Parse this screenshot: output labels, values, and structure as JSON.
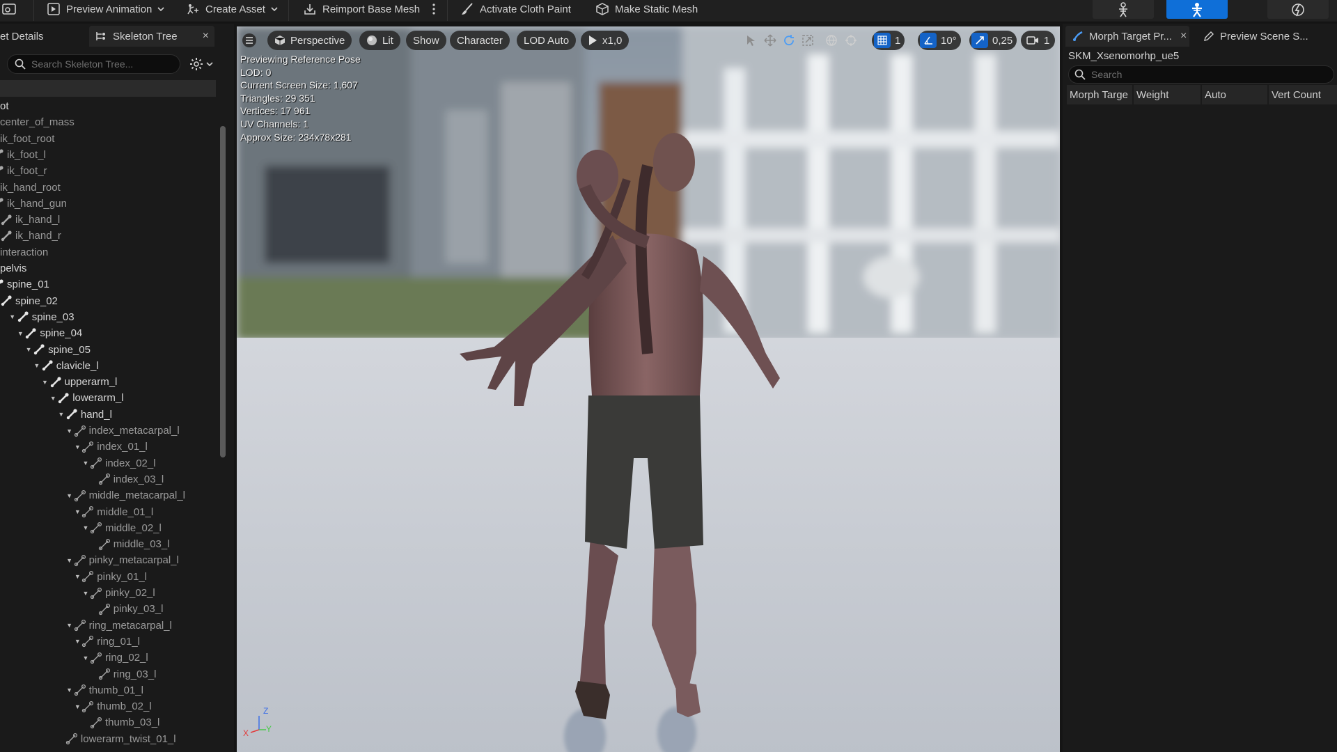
{
  "toolbar": {
    "preview_animation": "Preview Animation",
    "create_asset": "Create Asset",
    "reimport_base_mesh": "Reimport Base Mesh",
    "activate_cloth_paint": "Activate Cloth Paint",
    "make_static_mesh": "Make Static Mesh",
    "modes": [
      {
        "name": "skeleton-mode-icon",
        "active": false
      },
      {
        "name": "mesh-mode-icon",
        "active": true
      },
      {
        "name": "animation-mode-icon",
        "active": false
      }
    ]
  },
  "left_panel": {
    "tab_details": "et Details",
    "tab_skeleton_tree": "Skeleton Tree",
    "close": "×",
    "search_placeholder": "Search Skeleton Tree...",
    "tree": [
      {
        "label": "ot",
        "depth": 0,
        "dim": false,
        "arrow": false,
        "bone": false
      },
      {
        "label": "center_of_mass",
        "depth": 0,
        "dim": true,
        "arrow": false,
        "bone": false
      },
      {
        "label": "ik_foot_root",
        "depth": 0,
        "dim": true,
        "arrow": false,
        "bone": false
      },
      {
        "label": "ik_foot_l",
        "depth": 0,
        "dim": true,
        "arrow": false,
        "bone": "partial"
      },
      {
        "label": "ik_foot_r",
        "depth": 0,
        "dim": true,
        "arrow": false,
        "bone": "partial"
      },
      {
        "label": "ik_hand_root",
        "depth": 0,
        "dim": true,
        "arrow": false,
        "bone": false
      },
      {
        "label": "ik_hand_gun",
        "depth": 0,
        "dim": true,
        "arrow": false,
        "bone": "partial"
      },
      {
        "label": "ik_hand_l",
        "depth": 0,
        "dim": true,
        "arrow": false,
        "bone": true
      },
      {
        "label": "ik_hand_r",
        "depth": 0,
        "dim": true,
        "arrow": false,
        "bone": true
      },
      {
        "label": "interaction",
        "depth": 0,
        "dim": true,
        "arrow": false,
        "bone": false
      },
      {
        "label": "pelvis",
        "depth": 0,
        "dim": false,
        "arrow": false,
        "bone": false
      },
      {
        "label": "spine_01",
        "depth": 0,
        "dim": false,
        "arrow": false,
        "bone": "partial"
      },
      {
        "label": "spine_02",
        "depth": 0,
        "dim": false,
        "arrow": false,
        "bone": true
      },
      {
        "label": "spine_03",
        "depth": 1,
        "dim": false,
        "arrow": true,
        "bone": true
      },
      {
        "label": "spine_04",
        "depth": 2,
        "dim": false,
        "arrow": true,
        "bone": true
      },
      {
        "label": "spine_05",
        "depth": 3,
        "dim": false,
        "arrow": true,
        "bone": true
      },
      {
        "label": "clavicle_l",
        "depth": 4,
        "dim": false,
        "arrow": true,
        "bone": true
      },
      {
        "label": "upperarm_l",
        "depth": 5,
        "dim": false,
        "arrow": true,
        "bone": true
      },
      {
        "label": "lowerarm_l",
        "depth": 6,
        "dim": false,
        "arrow": true,
        "bone": true
      },
      {
        "label": "hand_l",
        "depth": 7,
        "dim": false,
        "arrow": true,
        "bone": true
      },
      {
        "label": "index_metacarpal_l",
        "depth": 8,
        "dim": true,
        "arrow": true,
        "bone": "outline"
      },
      {
        "label": "index_01_l",
        "depth": 9,
        "dim": true,
        "arrow": true,
        "bone": "outline"
      },
      {
        "label": "index_02_l",
        "depth": 10,
        "dim": true,
        "arrow": true,
        "bone": "outline"
      },
      {
        "label": "index_03_l",
        "depth": 11,
        "dim": true,
        "arrow": false,
        "bone": "outline"
      },
      {
        "label": "middle_metacarpal_l",
        "depth": 8,
        "dim": true,
        "arrow": true,
        "bone": "outline"
      },
      {
        "label": "middle_01_l",
        "depth": 9,
        "dim": true,
        "arrow": true,
        "bone": "outline"
      },
      {
        "label": "middle_02_l",
        "depth": 10,
        "dim": true,
        "arrow": true,
        "bone": "outline"
      },
      {
        "label": "middle_03_l",
        "depth": 11,
        "dim": true,
        "arrow": false,
        "bone": "outline"
      },
      {
        "label": "pinky_metacarpal_l",
        "depth": 8,
        "dim": true,
        "arrow": true,
        "bone": "outline"
      },
      {
        "label": "pinky_01_l",
        "depth": 9,
        "dim": true,
        "arrow": true,
        "bone": "outline"
      },
      {
        "label": "pinky_02_l",
        "depth": 10,
        "dim": true,
        "arrow": true,
        "bone": "outline"
      },
      {
        "label": "pinky_03_l",
        "depth": 11,
        "dim": true,
        "arrow": false,
        "bone": "outline"
      },
      {
        "label": "ring_metacarpal_l",
        "depth": 8,
        "dim": true,
        "arrow": true,
        "bone": "outline"
      },
      {
        "label": "ring_01_l",
        "depth": 9,
        "dim": true,
        "arrow": true,
        "bone": "outline"
      },
      {
        "label": "ring_02_l",
        "depth": 10,
        "dim": true,
        "arrow": true,
        "bone": "outline"
      },
      {
        "label": "ring_03_l",
        "depth": 11,
        "dim": true,
        "arrow": false,
        "bone": "outline"
      },
      {
        "label": "thumb_01_l",
        "depth": 8,
        "dim": true,
        "arrow": true,
        "bone": "outline"
      },
      {
        "label": "thumb_02_l",
        "depth": 9,
        "dim": true,
        "arrow": true,
        "bone": "outline"
      },
      {
        "label": "thumb_03_l",
        "depth": 10,
        "dim": true,
        "arrow": false,
        "bone": "outline"
      },
      {
        "label": "lowerarm_twist_01_l",
        "depth": 7,
        "dim": true,
        "arrow": false,
        "bone": "outline"
      }
    ]
  },
  "viewport": {
    "perspective": "Perspective",
    "lit": "Lit",
    "show": "Show",
    "character": "Character",
    "lod": "LOD Auto",
    "play_speed": "x1,0",
    "grid_snap": "1",
    "rot_snap": "10°",
    "scale_snap": "0,25",
    "camera_speed": "1",
    "stats": [
      "Previewing Reference Pose",
      "LOD: 0",
      "Current Screen Size: 1,607",
      "Triangles: 29 351",
      "Vertices: 17 961",
      "UV Channels: 1",
      "Approx Size: 234x78x281"
    ],
    "axis_x": "X",
    "axis_y": "Y",
    "axis_z": "Z"
  },
  "right_panel": {
    "tab_morph": "Morph Target Pr...",
    "close": "×",
    "tab_preview_scene": "Preview Scene S...",
    "asset_name": "SKM_Xsenomorhp_ue5",
    "search_placeholder": "Search",
    "columns": [
      "Morph Targe",
      "Weight",
      "Auto",
      "Vert Count"
    ]
  }
}
